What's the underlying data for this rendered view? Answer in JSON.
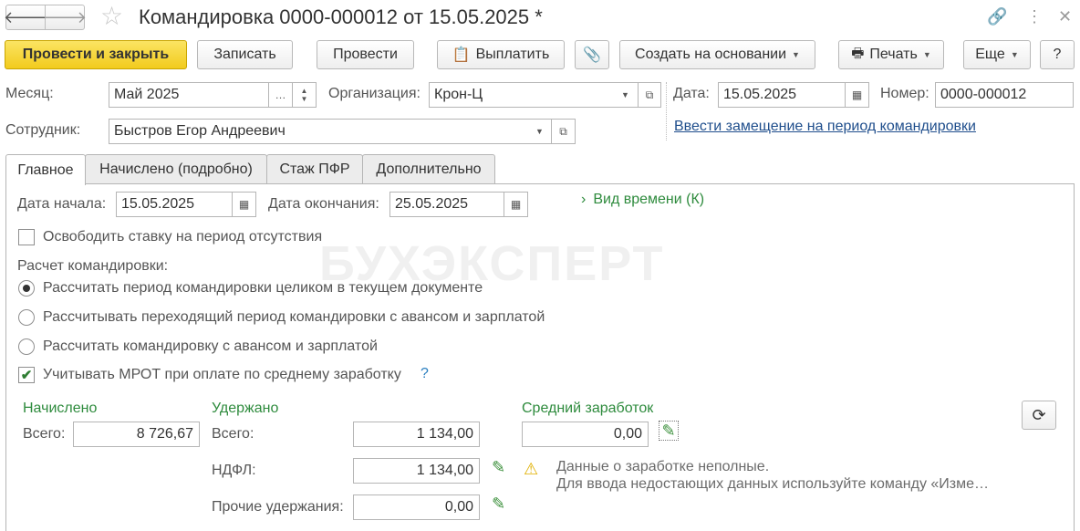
{
  "window": {
    "title": "Командировка 0000-000012 от 15.05.2025 *",
    "icons": [
      "arrow-left-icon",
      "arrow-right-icon",
      "star-icon",
      "link-icon",
      "more-vertical-icon",
      "close-icon"
    ]
  },
  "toolbar": {
    "post_close": "Провести и закрыть",
    "save": "Записать",
    "post": "Провести",
    "pay": "Выплатить",
    "create_based": "Создать на основании",
    "print": "Печать",
    "more": "Еще",
    "help": "?"
  },
  "header": {
    "month_label": "Месяц:",
    "month_value": "Май 2025",
    "org_label": "Организация:",
    "org_value": "Крон-Ц",
    "date_label": "Дата:",
    "date_value": "15.05.2025",
    "number_label": "Номер:",
    "number_value": "0000-000012",
    "employee_label": "Сотрудник:",
    "employee_value": "Быстров Егор Андреевич",
    "substitute_link": "Ввести замещение на период командировки"
  },
  "tabs": [
    {
      "label": "Главное",
      "active": true
    },
    {
      "label": "Начислено (подробно)",
      "active": false
    },
    {
      "label": "Стаж ПФР",
      "active": false
    },
    {
      "label": "Дополнительно",
      "active": false
    }
  ],
  "main": {
    "start_label": "Дата начала:",
    "start_value": "15.05.2025",
    "end_label": "Дата окончания:",
    "end_value": "25.05.2025",
    "time_type": "Вид времени (К)",
    "release_rate": {
      "label": "Освободить ставку на период отсутствия",
      "checked": false
    },
    "calc_label": "Расчет командировки:",
    "calc_options": [
      {
        "label": "Рассчитать период командировки целиком в текущем документе",
        "selected": true
      },
      {
        "label": "Рассчитывать переходящий период командировки с авансом и зарплатой",
        "selected": false
      },
      {
        "label": "Рассчитать командировку с авансом и зарплатой",
        "selected": false
      }
    ],
    "mrot": {
      "label": "Учитывать МРОТ при оплате по среднему заработку",
      "checked": true,
      "help": "?"
    },
    "accrued": {
      "heading": "Начислено",
      "total_label": "Всего:",
      "total_value": "8 726,67"
    },
    "withheld": {
      "heading": "Удержано",
      "total_label": "Всего:",
      "total_value": "1 134,00",
      "ndfl_label": "НДФЛ:",
      "ndfl_value": "1 134,00",
      "other_label": "Прочие удержания:",
      "other_value": "0,00"
    },
    "avg_earnings": {
      "heading": "Средний заработок",
      "value": "0,00"
    },
    "warning_line1": "Данные о заработке неполные.",
    "warning_line2": "Для ввода недостающих данных используйте команду «Изме…"
  },
  "watermark": "БУХЭКСПЕРТ",
  "colors": {
    "primary_button": "#f2cb1d",
    "link": "#1f4e8c",
    "green": "#2e8b3d"
  }
}
